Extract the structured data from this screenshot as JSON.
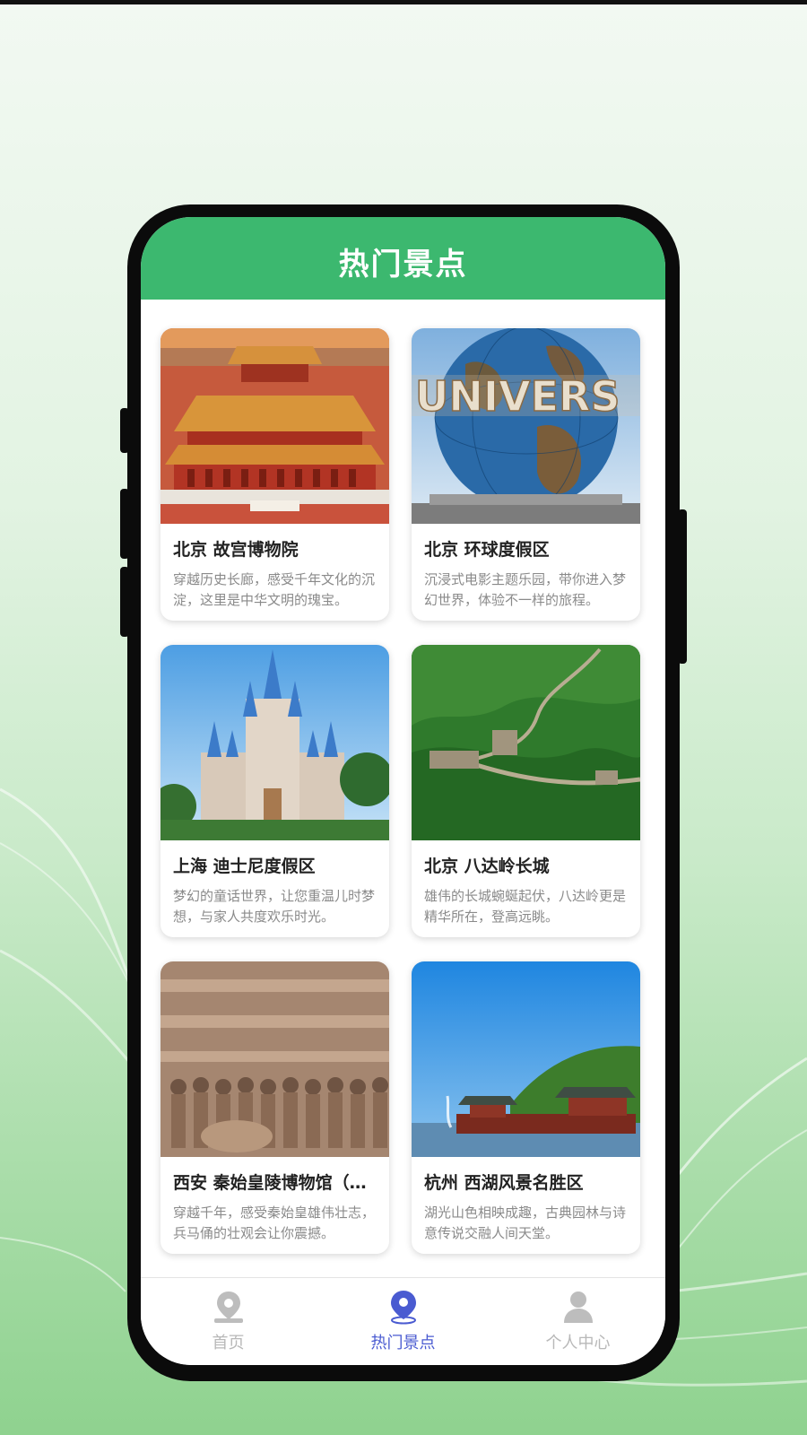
{
  "header": {
    "title": "热门景点"
  },
  "attractions": [
    {
      "title": "北京 故宫博物院",
      "desc": "穿越历史长廊，感受千年文化的沉淀，这里是中华文明的瑰宝。",
      "image": "forbidden-city"
    },
    {
      "title": "北京 环球度假区",
      "desc": "沉浸式电影主题乐园，带你进入梦幻世界，体验不一样的旅程。",
      "image": "universal-globe"
    },
    {
      "title": "上海 迪士尼度假区",
      "desc": "梦幻的童话世界，让您重温儿时梦想，与家人共度欢乐时光。",
      "image": "disney-castle"
    },
    {
      "title": "北京 八达岭长城",
      "desc": "雄伟的长城蜿蜒起伏，八达岭更是精华所在，登高远眺。",
      "image": "great-wall"
    },
    {
      "title": "西安 秦始皇陵博物馆（兵马俑）",
      "desc": "穿越千年，感受秦始皇雄伟壮志，兵马俑的壮观会让你震撼。",
      "image": "terracotta-army"
    },
    {
      "title": "杭州 西湖风景名胜区",
      "desc": "湖光山色相映成趣，古典园林与诗意传说交融人间天堂。",
      "image": "west-lake"
    }
  ],
  "nav": {
    "items": [
      {
        "label": "首页",
        "icon": "map-pin-icon"
      },
      {
        "label": "热门景点",
        "icon": "location-icon"
      },
      {
        "label": "个人中心",
        "icon": "user-icon"
      }
    ],
    "active": "热门景点"
  },
  "colors": {
    "header": "#3cb86f",
    "nav_active": "#4a5bd1",
    "nav_inactive": "#b8b8b8"
  }
}
